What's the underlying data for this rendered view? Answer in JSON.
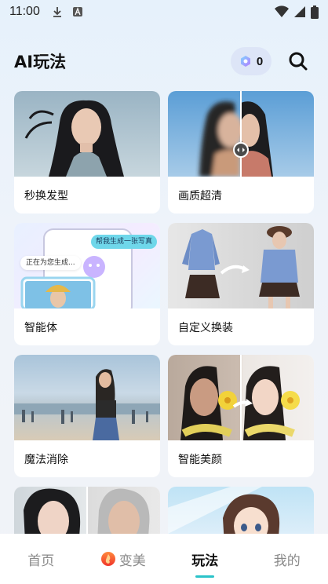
{
  "status": {
    "time": "11:00"
  },
  "header": {
    "title": "AI玩法",
    "coins": "0"
  },
  "cards": [
    {
      "label": "秒换发型"
    },
    {
      "label": "画质超清"
    },
    {
      "label": "智能体",
      "bubble_1": "帮我生成一张写真",
      "bubble_2": "正在为您生成..."
    },
    {
      "label": "自定义换装"
    },
    {
      "label": "魔法消除"
    },
    {
      "label": "智能美颜"
    },
    {
      "label": ""
    },
    {
      "label": ""
    }
  ],
  "tabs": [
    {
      "label": "首页"
    },
    {
      "label": "变美"
    },
    {
      "label": "玩法"
    },
    {
      "label": "我的"
    }
  ],
  "colors": {
    "accent": "#2ac3c9",
    "coin_bg": "#dde5f7"
  }
}
